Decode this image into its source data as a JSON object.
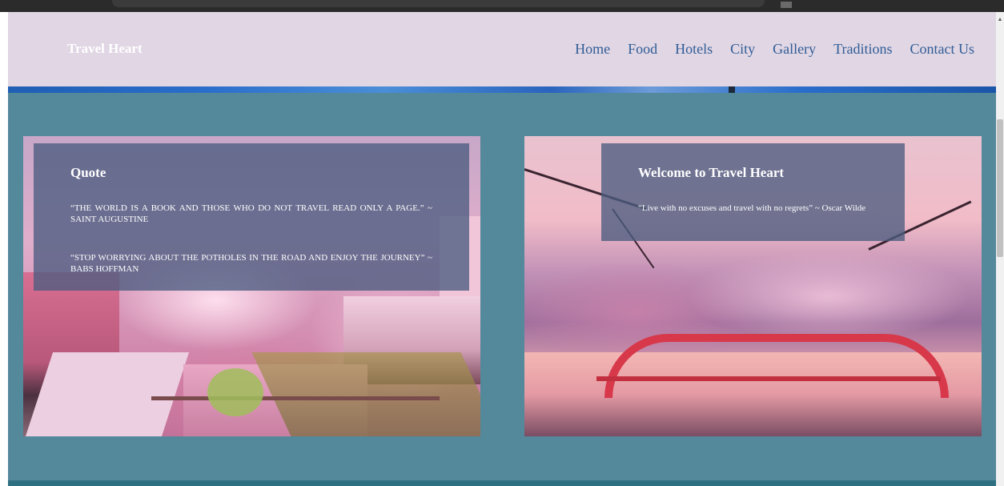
{
  "site": {
    "brand": "Travel Heart"
  },
  "nav": {
    "items": [
      {
        "label": "Home"
      },
      {
        "label": "Food"
      },
      {
        "label": "Hotels"
      },
      {
        "label": "City"
      },
      {
        "label": "Gallery"
      },
      {
        "label": "Traditions"
      },
      {
        "label": "Contact Us"
      }
    ]
  },
  "cards": [
    {
      "title": "Quote",
      "paragraphs": [
        "“THE WORLD IS A BOOK AND THOSE WHO DO NOT TRAVEL READ ONLY A PAGE.” ~ SAINT AUGUSTINE",
        "“STOP WORRYING ABOUT THE POTHOLES IN THE ROAD AND ENJOY THE JOURNEY” ~ BABS HOFFMAN"
      ]
    },
    {
      "title": "Welcome to Travel Heart",
      "paragraphs": [
        "“Live with no excuses and travel with no regrets” ~ Oscar Wilde"
      ]
    }
  ],
  "colors": {
    "navbar_bg": "#e1d6e4",
    "page_bg": "#54889b",
    "nav_link": "#2f5c96",
    "overlay": "#4c5c80"
  }
}
